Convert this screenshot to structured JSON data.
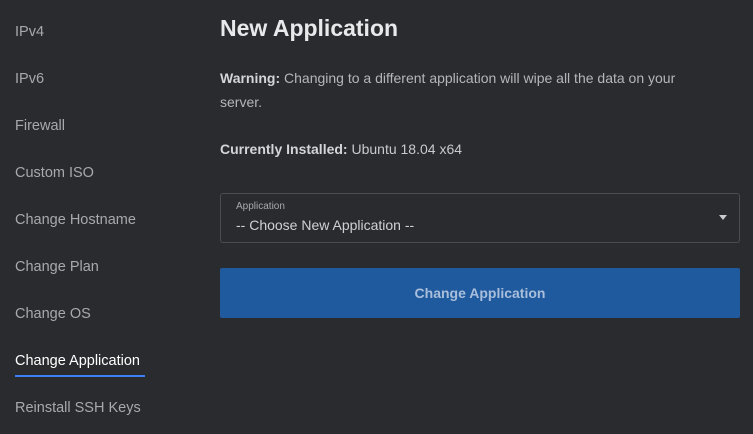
{
  "sidebar": {
    "items": [
      {
        "label": "IPv4"
      },
      {
        "label": "IPv6"
      },
      {
        "label": "Firewall"
      },
      {
        "label": "Custom ISO"
      },
      {
        "label": "Change Hostname"
      },
      {
        "label": "Change Plan"
      },
      {
        "label": "Change OS"
      },
      {
        "label": "Change Application",
        "active": true
      },
      {
        "label": "Reinstall SSH Keys"
      }
    ]
  },
  "main": {
    "title": "New Application",
    "warning_label": "Warning:",
    "warning_text": "Changing to a different application will wipe all the data on your server.",
    "installed_label": "Currently Installed:",
    "installed_value": "Ubuntu 18.04 x64",
    "select": {
      "label": "Application",
      "value": "-- Choose New Application --"
    },
    "submit_label": "Change Application"
  },
  "colors": {
    "background": "#2a2b2f",
    "accent": "#3b82f6",
    "button": "#1f5a9e"
  },
  "icons": {
    "select_caret": "caret-down-icon"
  }
}
